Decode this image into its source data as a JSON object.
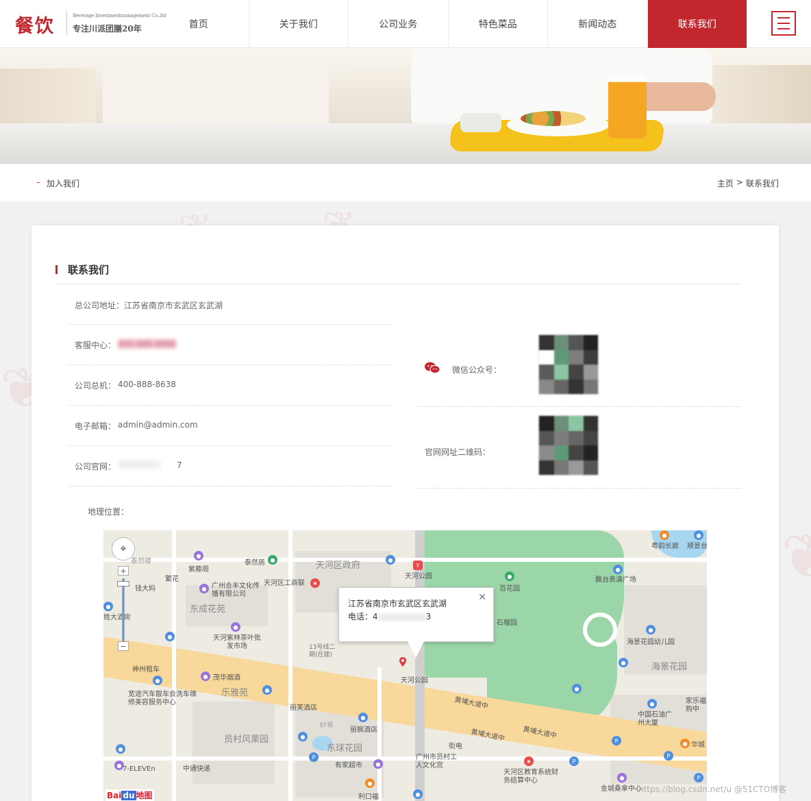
{
  "brand": {
    "logo_text": "餐饮",
    "logo_en": "Beverage Investmentmanagement Co.,ltd",
    "slogan": "专注川派团膳20年"
  },
  "nav": {
    "items": [
      "首页",
      "关于我们",
      "公司业务",
      "特色菜品",
      "新闻动态",
      "联系我们"
    ],
    "active": "联系我们"
  },
  "subnav": {
    "title": "加入我们",
    "breadcrumb_home": "主页",
    "breadcrumb_sep": ">",
    "breadcrumb_current": "联系我们"
  },
  "contact": {
    "section_title": "联系我们",
    "address_label": "总公司地址：",
    "address": "江苏省南京市玄武区玄武湖",
    "service_label": "客服中心：",
    "service_value": "400-888-8888",
    "phone_label": "公司总机：",
    "phone_value": "400-888-8638",
    "email_label": "电子邮箱：",
    "email_value": "admin@admin.com",
    "website_label": "公司官网：",
    "website_tail": "7",
    "wechat_label": "微信公众号：",
    "qr_label": "官网网址二维码：",
    "geo_label": "地理位置："
  },
  "map": {
    "info_line1": "江苏省南京市玄武区玄武湖",
    "info_phone_prefix": "电话：",
    "info_phone_start": "4",
    "info_phone_end": "3",
    "labels": {
      "tianhe_gov": "天河区政府",
      "tianhe_park": "天河公园",
      "tianhe_park2": "天河公园",
      "baihua": "百花园",
      "shiyuan": "石榴园",
      "piaotai": "飘台表演广场",
      "haijing_kinder": "海景花园幼儿园",
      "haijing": "海景花园",
      "dongcheng": "东成花苑",
      "dongcheng2": "东球花园",
      "leyayuan": "乐雅苑",
      "yuancun": "员村风栗园",
      "huangpu1": "黄埔大道中",
      "huangpu2": "黄埔大道中",
      "huangpu3": "黄埔大道中",
      "line13": "13号线二期(在建)",
      "tianhe_gongshang": "天河区工商联",
      "guangzhou_hefeng": "广州合丰文化传播有限公司",
      "ziying": "紫藤阁",
      "fanhua": "繁花",
      "qiandama": "钱大妈",
      "qinrange": "泰然居",
      "tianhe_tea": "天河紫林茶叶批发市场",
      "shenzhou": "神州租车",
      "maohua": "茂华烟酒",
      "kuantu": "宽途汽车靓车会洗车维修美容服务中心",
      "yingfu": "丽芙酒店",
      "lifeng": "丽枫酒店",
      "seven": "7-ELEVEn",
      "zhongtong": "中通快递",
      "youjia": "有家超市",
      "likou": "利口福",
      "yuancun_gongren": "广州市员村工人文化宫",
      "jiedian": "街电",
      "tianhe_edu": "天河区教育系统财务结算中心",
      "jinchengsang": "金城桑拿中心",
      "zhongguo_shiyou": "中国石油广州大厦",
      "jiale": "家乐福采购中",
      "huacheng": "华城",
      "yuanyun": "粤韵长廊",
      "shunjingtai": "顺景台",
      "taihelou": "泰然楼",
      "jiadajiu": "姓大酒房",
      "ef": "EF栋",
      "bai": "Bai",
      "du": "du",
      "ditu": "地图"
    }
  },
  "watermark": "https://blog.csdn.net/u @51CTO博客"
}
